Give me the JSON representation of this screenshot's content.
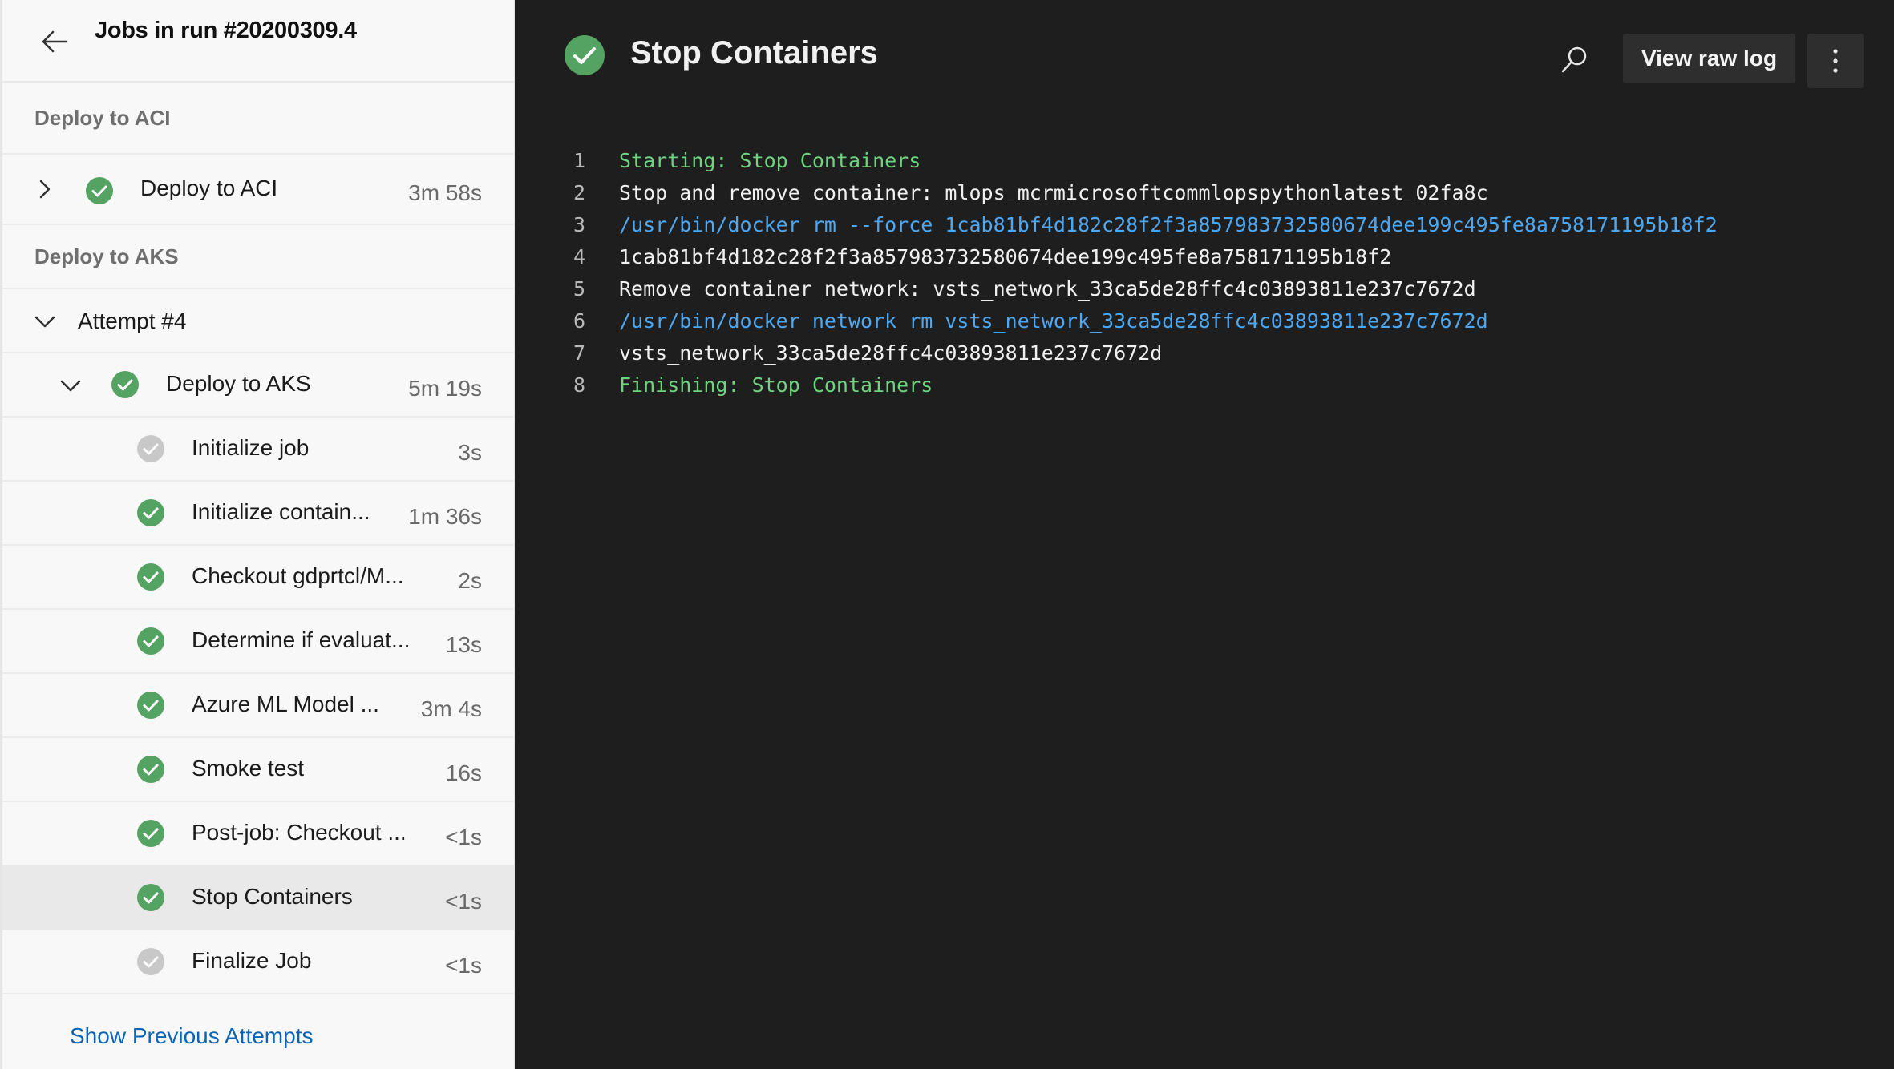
{
  "sidebar": {
    "title": "Jobs in run #20200309.4",
    "section_aci": "Deploy to ACI",
    "aci_job": {
      "label": "Deploy to ACI",
      "duration": "3m 58s"
    },
    "section_aks": "Deploy to AKS",
    "attempt": "Attempt #4",
    "aks_job": {
      "label": "Deploy to AKS",
      "duration": "5m 19s"
    },
    "steps": [
      {
        "label": "Initialize job",
        "duration": "3s",
        "status": "pending"
      },
      {
        "label": "Initialize contain...",
        "duration": "1m 36s",
        "status": "success"
      },
      {
        "label": "Checkout gdprtcl/M...",
        "duration": "2s",
        "status": "success"
      },
      {
        "label": "Determine if evaluat...",
        "duration": "13s",
        "status": "success"
      },
      {
        "label": "Azure ML Model ...",
        "duration": "3m 4s",
        "status": "success"
      },
      {
        "label": "Smoke test",
        "duration": "16s",
        "status": "success"
      },
      {
        "label": "Post-job: Checkout ...",
        "duration": "<1s",
        "status": "success"
      },
      {
        "label": "Stop Containers",
        "duration": "<1s",
        "status": "success"
      },
      {
        "label": "Finalize Job",
        "duration": "<1s",
        "status": "pending"
      }
    ],
    "show_previous": "Show Previous Attempts"
  },
  "main": {
    "title": "Stop Containers",
    "raw_log_label": "View raw log",
    "log_lines": [
      {
        "num": "1",
        "text": "Starting: Stop Containers",
        "color": "green"
      },
      {
        "num": "2",
        "text": "Stop and remove container: mlops_mcrmicrosoftcommlopspythonlatest_02fa8c",
        "color": "white"
      },
      {
        "num": "3",
        "text": "/usr/bin/docker rm --force 1cab81bf4d182c28f2f3a857983732580674dee199c495fe8a758171195b18f2",
        "color": "blue"
      },
      {
        "num": "4",
        "text": "1cab81bf4d182c28f2f3a857983732580674dee199c495fe8a758171195b18f2",
        "color": "white"
      },
      {
        "num": "5",
        "text": "Remove container network: vsts_network_33ca5de28ffc4c03893811e237c7672d",
        "color": "white"
      },
      {
        "num": "6",
        "text": "/usr/bin/docker network rm vsts_network_33ca5de28ffc4c03893811e237c7672d",
        "color": "blue"
      },
      {
        "num": "7",
        "text": "vsts_network_33ca5de28ffc4c03893811e237c7672d",
        "color": "white"
      },
      {
        "num": "8",
        "text": "Finishing: Stop Containers",
        "color": "green"
      }
    ]
  },
  "colors": {
    "success": "#55a362",
    "pending": "#c8c8c8",
    "link": "#0b64b6"
  }
}
